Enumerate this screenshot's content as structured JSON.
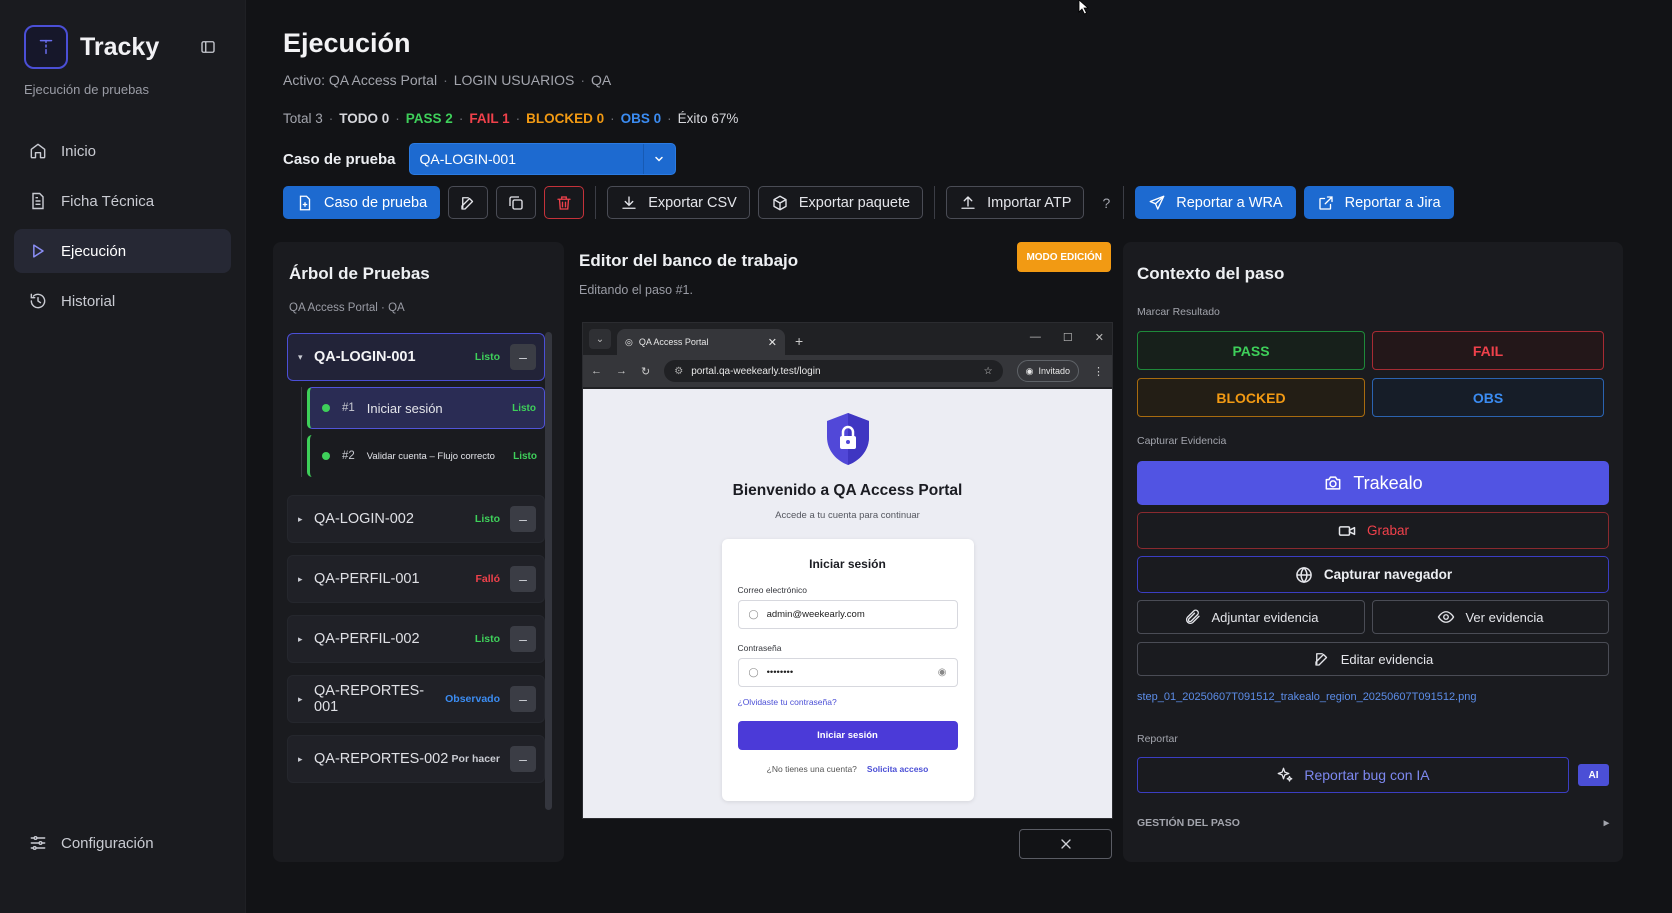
{
  "app": {
    "name": "Tracky",
    "subtitle": "Ejecución de pruebas"
  },
  "nav": {
    "items": [
      {
        "label": "Inicio",
        "icon": "home-icon"
      },
      {
        "label": "Ficha Técnica",
        "icon": "document-icon"
      },
      {
        "label": "Ejecución",
        "icon": "play-icon",
        "active": true
      },
      {
        "label": "Historial",
        "icon": "history-icon"
      }
    ],
    "settings_label": "Configuración"
  },
  "header": {
    "title": "Ejecución",
    "active_label": "Activo: QA Access Portal",
    "suite": "LOGIN USUARIOS",
    "env": "QA",
    "sep": "·"
  },
  "stats": {
    "total": "Total 3",
    "todo": "TODO 0",
    "pass": "PASS 2",
    "fail": "FAIL 1",
    "blocked": "BLOCKED 0",
    "obs": "OBS 0",
    "exito": "Éxito 67%"
  },
  "case_select": {
    "label": "Caso de prueba",
    "value": "QA-LOGIN-001"
  },
  "toolbar": {
    "new_case": "Caso de prueba",
    "export_csv": "Exportar CSV",
    "export_package": "Exportar paquete",
    "import_atp": "Importar ATP",
    "help": "?",
    "report_wra": "Reportar a WRA",
    "report_jira": "Reportar a Jira"
  },
  "tree": {
    "title": "Árbol de Pruebas",
    "subtitle": "QA Access Portal · QA",
    "minus": "–",
    "nodes": [
      {
        "code": "QA-LOGIN-001",
        "status": "Listo",
        "expanded": true
      },
      {
        "code": "QA-LOGIN-002",
        "status": "Listo"
      },
      {
        "code": "QA-PERFIL-001",
        "status": "Falló"
      },
      {
        "code": "QA-PERFIL-002",
        "status": "Listo"
      },
      {
        "code": "QA-REPORTES-001",
        "status": "Observado"
      },
      {
        "code": "QA-REPORTES-002",
        "status": "Por hacer"
      }
    ],
    "steps": [
      {
        "num": "#1",
        "text": "Iniciar sesión",
        "status": "Listo"
      },
      {
        "num": "#2",
        "text": "Validar cuenta – Flujo correcto",
        "status": "Listo"
      }
    ]
  },
  "editor": {
    "title": "Editor del banco de trabajo",
    "mode": "MODO EDICIÓN",
    "subtitle": "Editando el paso #1.",
    "browser": {
      "tab_title": "QA Access Portal",
      "url": "portal.qa-weekearly.test/login",
      "guest": "Invitado"
    },
    "page": {
      "welcome": "Bienvenido a QA Access Portal",
      "welcome_sub": "Accede a tu cuenta para continuar",
      "card_title": "Iniciar sesión",
      "email_label": "Correo electrónico",
      "email_value": "admin@weekearly.com",
      "password_label": "Contraseña",
      "password_value": "••••••••",
      "forgot": "¿Olvidaste tu contraseña?",
      "login_button": "Iniciar sesión",
      "no_account": "¿No tienes una cuenta?",
      "request_access": "Solicita acceso"
    }
  },
  "context": {
    "title": "Contexto del paso",
    "mark_label": "Marcar Resultado",
    "results": {
      "pass": "PASS",
      "fail": "FAIL",
      "blocked": "BLOCKED",
      "obs": "OBS"
    },
    "capture_label": "Capturar Evidencia",
    "trakealo": "Trakealo",
    "grabar": "Grabar",
    "capture_browser": "Capturar navegador",
    "attach": "Adjuntar evidencia",
    "view": "Ver evidencia",
    "edit": "Editar evidencia",
    "file": "step_01_20250607T091512_trakealo_region_20250607T091512.png",
    "report_label": "Reportar",
    "bug_ai": "Reportar bug con IA",
    "ai_badge": "AI",
    "gestion": "GESTIÓN DEL PASO",
    "gestion_arrow": "▸"
  },
  "colors": {
    "accent": "#4b4fd6",
    "primary_blue": "#1d6ad0",
    "pass": "#3ecf5a",
    "fail": "#f0414b",
    "blocked": "#f29a13",
    "obs": "#3b8cf2"
  }
}
